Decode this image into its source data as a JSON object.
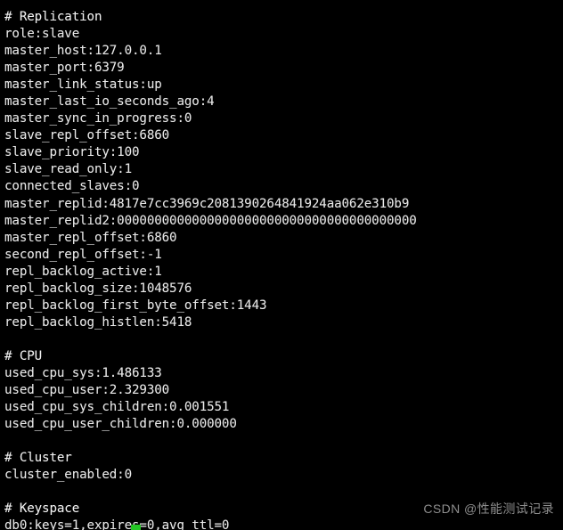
{
  "terminal": {
    "background_color": "#000000",
    "text_color": "#e8e8e8",
    "cursor_color": "#25c425",
    "lines": [
      "# Replication",
      "role:slave",
      "master_host:127.0.0.1",
      "master_port:6379",
      "master_link_status:up",
      "master_last_io_seconds_ago:4",
      "master_sync_in_progress:0",
      "slave_repl_offset:6860",
      "slave_priority:100",
      "slave_read_only:1",
      "connected_slaves:0",
      "master_replid:4817e7cc3969c2081390264841924aa062e310b9",
      "master_replid2:0000000000000000000000000000000000000000",
      "master_repl_offset:6860",
      "second_repl_offset:-1",
      "repl_backlog_active:1",
      "repl_backlog_size:1048576",
      "repl_backlog_first_byte_offset:1443",
      "repl_backlog_histlen:5418",
      "",
      "# CPU",
      "used_cpu_sys:1.486133",
      "used_cpu_user:2.329300",
      "used_cpu_sys_children:0.001551",
      "used_cpu_user_children:0.000000",
      "",
      "# Cluster",
      "cluster_enabled:0",
      "",
      "# Keyspace",
      "db0:keys=1,expires=0,avg_ttl=0"
    ],
    "sections": [
      {
        "header": "# Replication",
        "fields": [
          {
            "key": "role",
            "value": "slave"
          },
          {
            "key": "master_host",
            "value": "127.0.0.1"
          },
          {
            "key": "master_port",
            "value": "6379"
          },
          {
            "key": "master_link_status",
            "value": "up"
          },
          {
            "key": "master_last_io_seconds_ago",
            "value": "4"
          },
          {
            "key": "master_sync_in_progress",
            "value": "0"
          },
          {
            "key": "slave_repl_offset",
            "value": "6860"
          },
          {
            "key": "slave_priority",
            "value": "100"
          },
          {
            "key": "slave_read_only",
            "value": "1"
          },
          {
            "key": "connected_slaves",
            "value": "0"
          },
          {
            "key": "master_replid",
            "value": "4817e7cc3969c2081390264841924aa062e310b9"
          },
          {
            "key": "master_replid2",
            "value": "0000000000000000000000000000000000000000"
          },
          {
            "key": "master_repl_offset",
            "value": "6860"
          },
          {
            "key": "second_repl_offset",
            "value": "-1"
          },
          {
            "key": "repl_backlog_active",
            "value": "1"
          },
          {
            "key": "repl_backlog_size",
            "value": "1048576"
          },
          {
            "key": "repl_backlog_first_byte_offset",
            "value": "1443"
          },
          {
            "key": "repl_backlog_histlen",
            "value": "5418"
          }
        ]
      },
      {
        "header": "# CPU",
        "fields": [
          {
            "key": "used_cpu_sys",
            "value": "1.486133"
          },
          {
            "key": "used_cpu_user",
            "value": "2.329300"
          },
          {
            "key": "used_cpu_sys_children",
            "value": "0.001551"
          },
          {
            "key": "used_cpu_user_children",
            "value": "0.000000"
          }
        ]
      },
      {
        "header": "# Cluster",
        "fields": [
          {
            "key": "cluster_enabled",
            "value": "0"
          }
        ]
      },
      {
        "header": "# Keyspace",
        "fields": [
          {
            "key": "db0",
            "value": "keys=1,expires=0,avg_ttl=0"
          }
        ]
      }
    ]
  },
  "watermark": {
    "text": "CSDN @性能测试记录"
  }
}
